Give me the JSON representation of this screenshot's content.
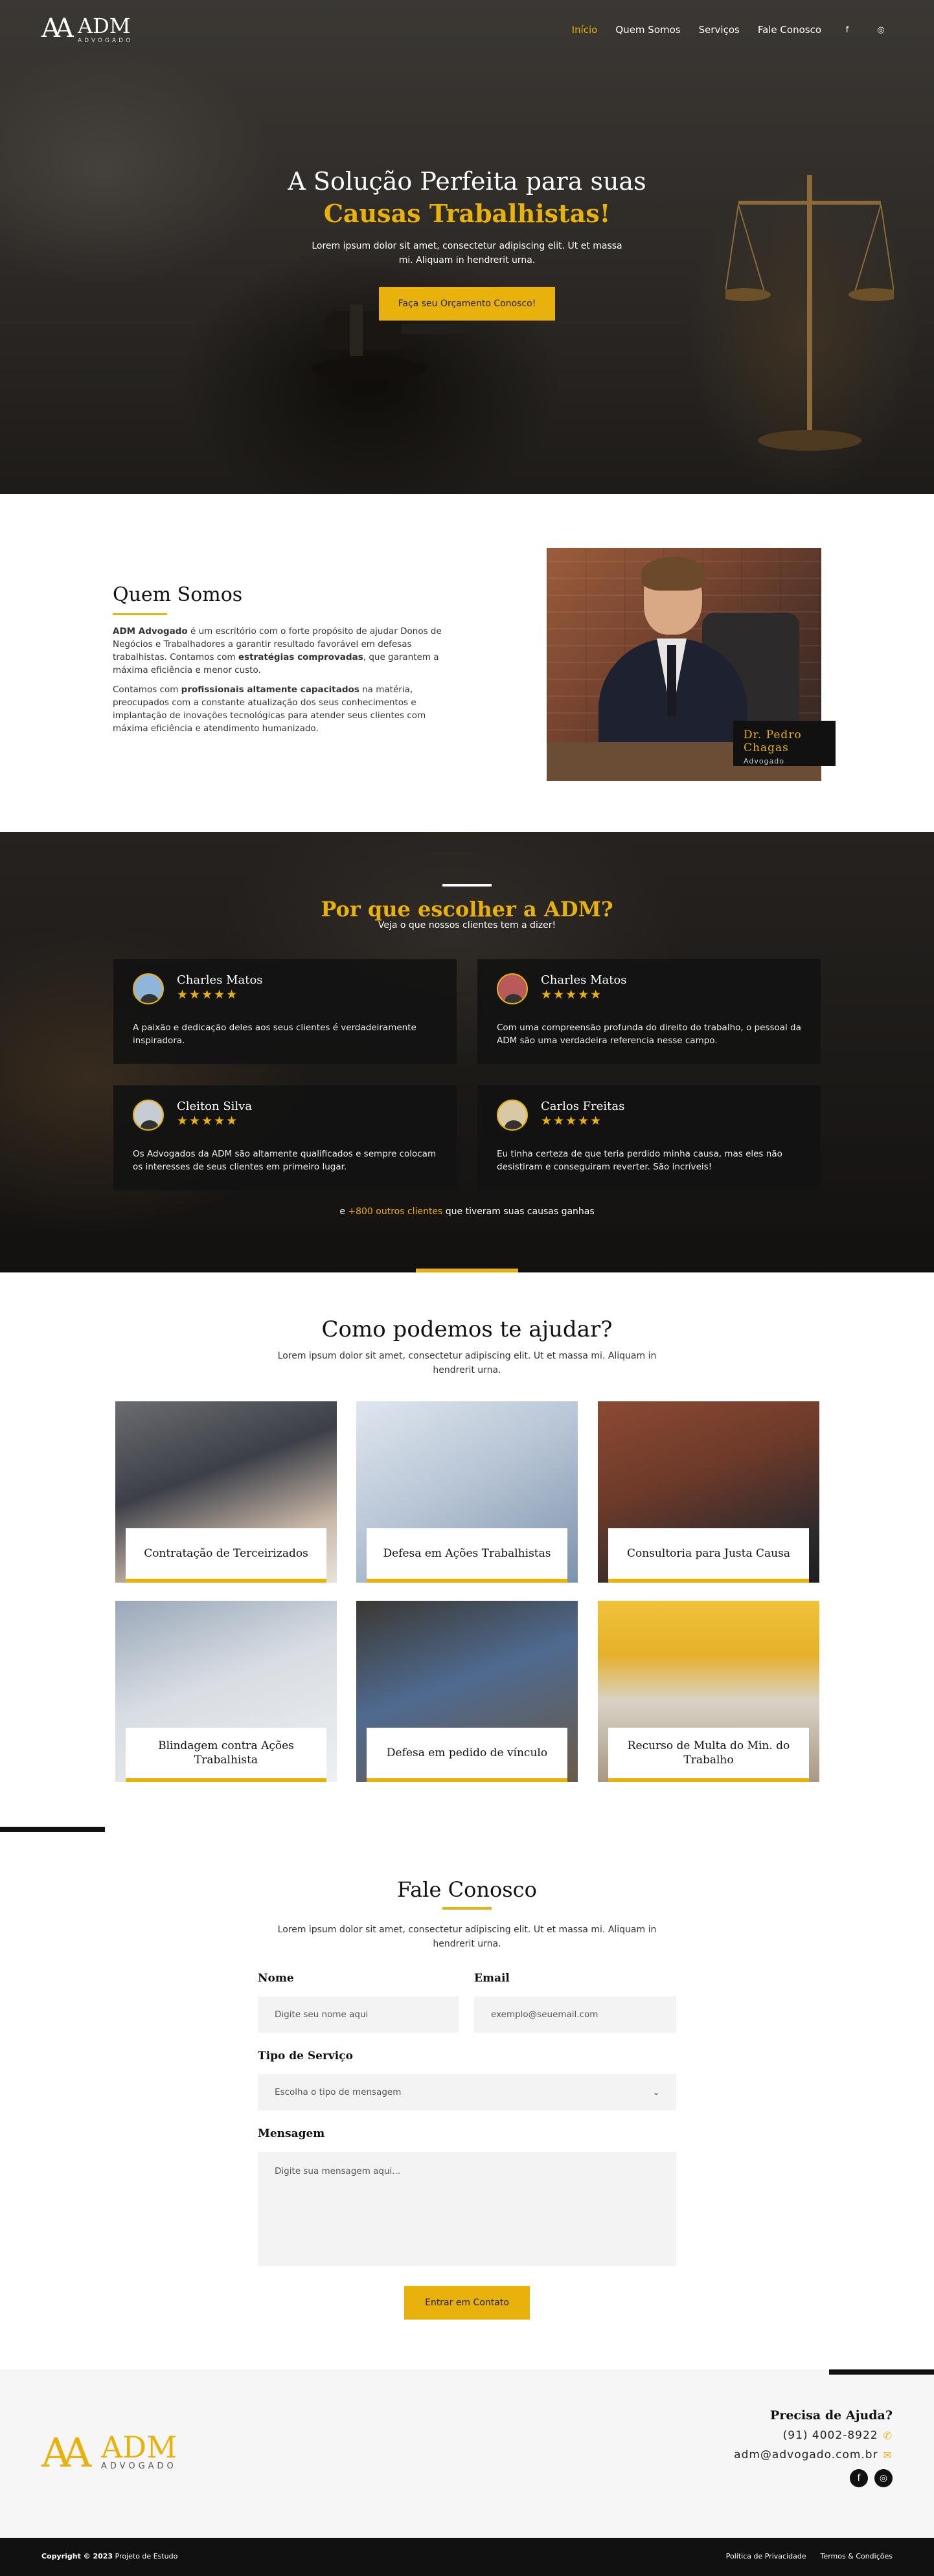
{
  "nav": {
    "logo_mark": "AA",
    "logo_name": "ADM",
    "logo_sub": "ADVOGADO",
    "items": [
      {
        "label": "Início",
        "active": true
      },
      {
        "label": "Quem Somos"
      },
      {
        "label": "Serviços"
      },
      {
        "label": "Fale Conosco"
      }
    ],
    "social_facebook": "f",
    "social_instagram": "◎"
  },
  "hero": {
    "title_line1": "A Solução Perfeita para suas",
    "title_line2": "Causas Trabalhistas!",
    "text": "Lorem ipsum dolor sit amet, consectetur adipiscing elit. Ut et massa mi. Aliquam in hendrerit urna.",
    "button": "Faça seu Orçamento Conosco!"
  },
  "about": {
    "title": "Quem Somos",
    "p1_bold": "ADM Advogado",
    "p1_a": " é um escritório com o forte propósito de ajudar Donos de Negócios e Trabalhadores a garantir resultado favorável em defesas trabalhistas. Contamos com ",
    "p1_bold2": "estratégias comprovadas",
    "p1_b": ", que garantem a máxima eficiência e menor custo.",
    "p2_a": "Contamos com ",
    "p2_bold": "profissionais altamente capacitados",
    "p2_b": " na matéria, preocupados com a constante atualização dos seus conhecimentos e implantação de inovações tecnológicas para atender seus clientes com máxima eficiência e atendimento humanizado.",
    "badge_name": "Dr. Pedro Chagas",
    "badge_role": "Advogado"
  },
  "testimonials": {
    "title": "Por que escolher a ADM?",
    "subtitle": "Veja o que nossos  clientes tem a dizer!",
    "items": [
      {
        "name": "Charles Matos",
        "stars": "★★★★★",
        "text": "A paixão e dedicação deles aos seus clientes é verdadeiramente inspiradora."
      },
      {
        "name": "Charles Matos",
        "stars": "★★★★★",
        "text": "Com uma compreensão profunda do direito do trabalho, o pessoal da ADM são uma verdadeira referencia nesse campo."
      },
      {
        "name": "Cleiton Silva",
        "stars": "★★★★★",
        "text": "Os Advogados da ADM são altamente qualificados e sempre colocam os interesses de seus clientes em primeiro lugar."
      },
      {
        "name": "Carlos Freitas",
        "stars": "★★★★★",
        "text": "Eu tinha certeza de que teria perdido minha causa, mas eles não desistiram e conseguiram reverter. São incríveis!"
      }
    ],
    "more_prefix": "e ",
    "more_highlight": "+800 outros clientes",
    "more_suffix": " que tiveram suas causas ganhas"
  },
  "services": {
    "title": "Como podemos te ajudar?",
    "subtitle": "Lorem ipsum dolor sit amet, consectetur adipiscing elit. Ut et massa mi. Aliquam in hendrerit urna.",
    "items": [
      {
        "label": "Contratação de Terceirizados"
      },
      {
        "label": "Defesa em Ações Trabalhistas"
      },
      {
        "label": "Consultoria para Justa Causa"
      },
      {
        "label": "Blindagem contra Ações Trabalhista"
      },
      {
        "label": "Defesa em pedido de vínculo"
      },
      {
        "label": "Recurso de Multa do Min. do Trabalho"
      }
    ]
  },
  "contact": {
    "title": "Fale Conosco",
    "subtitle": "Lorem ipsum dolor sit amet, consectetur adipiscing elit. Ut et massa mi. Aliquam in hendrerit urna.",
    "name_label": "Nome",
    "name_placeholder": "Digite seu nome aqui",
    "email_label": "Email",
    "email_placeholder": "exemplo@seuemail.com",
    "service_label": "Tipo de Serviço",
    "service_placeholder": "Escolha o tipo de mensagem",
    "message_label": "Mensagem",
    "message_placeholder": "Digite sua mensagem aqui...",
    "button": "Entrar em Contato"
  },
  "footer": {
    "logo_mark": "AA",
    "logo_name": "ADM",
    "logo_sub": "ADVOGADO",
    "help_title": "Precisa de Ajuda?",
    "phone": "(91) 4002-8922",
    "email": "adm@advogado.com.br",
    "copyright_bold": "Copyright © 2023",
    "copyright_rest": " Projeto de Estudo",
    "privacy": "Política de Privacidade",
    "terms": "Termos & Condições"
  },
  "colors": {
    "accent": "#e8b10c",
    "dark": "#111111"
  }
}
